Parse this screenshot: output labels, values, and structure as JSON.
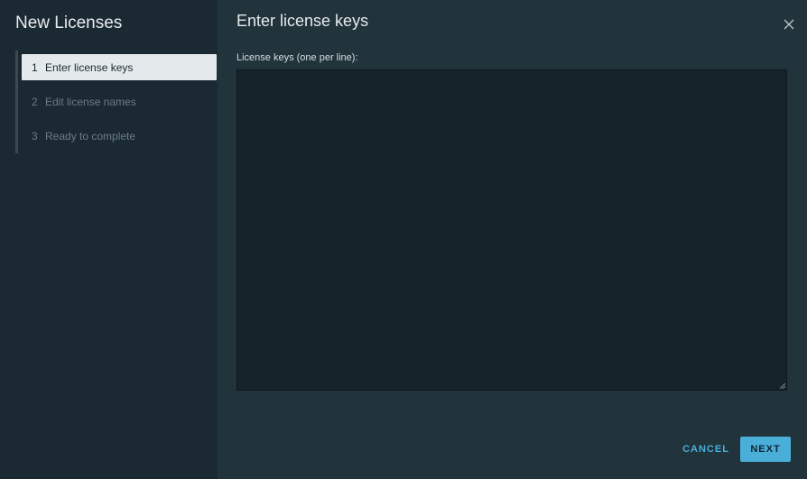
{
  "sidebar": {
    "title": "New Licenses",
    "steps": [
      {
        "number": "1",
        "label": "Enter license keys",
        "active": true
      },
      {
        "number": "2",
        "label": "Edit license names",
        "active": false
      },
      {
        "number": "3",
        "label": "Ready to complete",
        "active": false
      }
    ]
  },
  "main": {
    "title": "Enter license keys",
    "close_icon": "close-icon",
    "field": {
      "label": "License keys (one per line):",
      "value": "",
      "placeholder": ""
    }
  },
  "footer": {
    "cancel_label": "CANCEL",
    "next_label": "NEXT"
  },
  "colors": {
    "sidebar_bg": "#1b2a32",
    "main_bg": "#21333b",
    "accent": "#49afd9",
    "active_step_bg": "#e4e9ec"
  }
}
